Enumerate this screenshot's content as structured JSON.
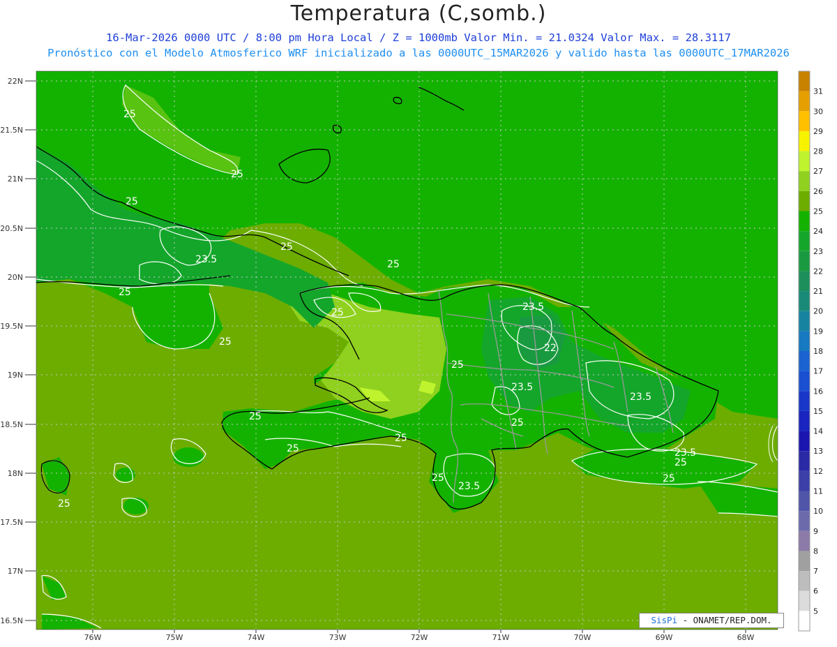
{
  "title": "Temperatura (C,somb.)",
  "subtitle_line1": "16-Mar-2026  0000 UTC / 8:00 pm Hora Local / Z = 1000mb   Valor Min. = 21.0324  Valor Max. = 28.3117",
  "subtitle_line2": "Pronóstico con el Modelo Atmosferico WRF inicializado a las 0000UTC_15MAR2026 y valido hasta las  0000UTC_17MAR2026",
  "lat_labels": [
    "22N",
    "21.5N",
    "21N",
    "20.5N",
    "20N",
    "19.5N",
    "19N",
    "18.5N",
    "18N",
    "17.5N",
    "17N",
    "16.5N"
  ],
  "lon_labels": [
    "76W",
    "75W",
    "74W",
    "73W",
    "72W",
    "71W",
    "70W",
    "69W",
    "68W"
  ],
  "contour_labels": [
    "25",
    "25",
    "25",
    "23.5",
    "25",
    "25",
    "25",
    "25",
    "25",
    "23.5",
    "22",
    "25",
    "23.5",
    "23.5",
    "25",
    "25",
    "25",
    "25",
    "23.5",
    "25",
    "23.5",
    "25",
    "25",
    "25"
  ],
  "colorbar": {
    "labels": [
      "31",
      "30",
      "29",
      "28",
      "27",
      "26",
      "25",
      "24",
      "23",
      "22",
      "21",
      "20",
      "19",
      "18",
      "17",
      "16",
      "15",
      "14",
      "13",
      "12",
      "11",
      "10",
      "9",
      "8",
      "7",
      "6",
      "5"
    ],
    "colors": [
      "#c88200",
      "#e69f00",
      "#ffc000",
      "#f7f200",
      "#bff32e",
      "#8fd11e",
      "#6cad00",
      "#14b200",
      "#14a62b",
      "#1a9a40",
      "#1d8f5b",
      "#198a78",
      "#1684a0",
      "#1779bf",
      "#1a63d0",
      "#1a4fd2",
      "#1937c8",
      "#1a25c0",
      "#1c16b0",
      "#2a29a6",
      "#3b3fa7",
      "#5055aa",
      "#6c6aab",
      "#8c7aa8",
      "#a0a0a0",
      "#bdbdbd",
      "#dcdcdc",
      "#ffffff"
    ]
  },
  "credit": {
    "brand": "SisPi",
    "text": " - ONAMET/REP.DOM."
  },
  "colors": {
    "sea": "#6cad00",
    "land_24": "#14b200",
    "land_23": "#14a62b",
    "land_22": "#1a9a40",
    "land_26": "#8fd11e",
    "land_27": "#bff32e",
    "coast": "#000000",
    "border": "#9a9a9a",
    "contour": "#ffffff"
  }
}
